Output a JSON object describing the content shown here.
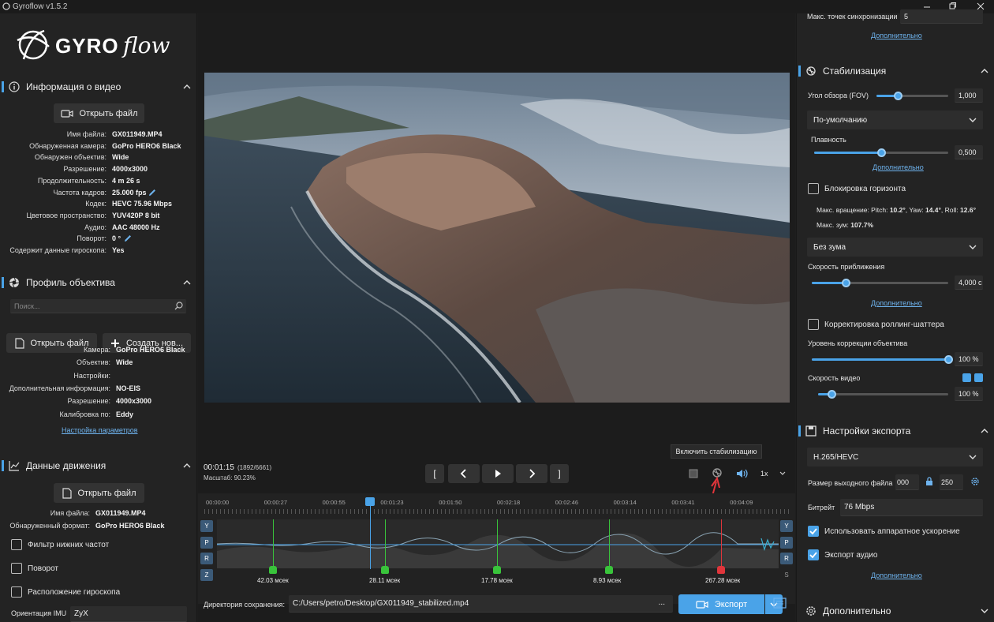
{
  "app": {
    "title": "Gyroflow v1.5.2",
    "logo_text": "GYROflow"
  },
  "colors": {
    "accent": "#4aa3e8",
    "sync_ok": "#39c43b",
    "sync_bad": "#e0353b"
  },
  "video_info": {
    "title": "Информация о видео",
    "open_btn": "Открыть файл",
    "rows": [
      {
        "k": "Имя файла:",
        "v": "GX011949.MP4"
      },
      {
        "k": "Обнаруженная камера:",
        "v": "GoPro HERO6 Black"
      },
      {
        "k": "Обнаружен объектив:",
        "v": "Wide"
      },
      {
        "k": "Разрешение:",
        "v": "4000x3000"
      },
      {
        "k": "Продолжительность:",
        "v": "4 m 26 s"
      },
      {
        "k": "Частота кадров:",
        "v": "25.000 fps"
      },
      {
        "k": "Кодек:",
        "v": "HEVC 75.96 Mbps"
      },
      {
        "k": "Цветовое пространство:",
        "v": "YUV420P 8 bit"
      },
      {
        "k": "Аудио:",
        "v": "AAC 48000 Hz"
      },
      {
        "k": "Поворот:",
        "v": "0 °"
      },
      {
        "k": "Содержит данные гироскопа:",
        "v": "Yes"
      }
    ]
  },
  "lens_profile": {
    "title": "Профиль объектива",
    "search_placeholder": "Поиск...",
    "open_btn": "Открыть файл",
    "create_btn": "Создать нов...",
    "rows": [
      {
        "k": "Камера:",
        "v": "GoPro HERO6 Black"
      },
      {
        "k": "Объектив:",
        "v": "Wide"
      },
      {
        "k": "Настройки:",
        "v": ""
      },
      {
        "k": "Дополнительная информация:",
        "v": "NO-EIS"
      },
      {
        "k": "Разрешение:",
        "v": "4000x3000"
      },
      {
        "k": "Калибровка по:",
        "v": "Eddy"
      }
    ],
    "link": "Настройка параметров"
  },
  "motion": {
    "title": "Данные движения",
    "open_btn": "Открыть файл",
    "rows": [
      {
        "k": "Имя файла:",
        "v": "GX011949.MP4"
      },
      {
        "k": "Обнаруженный формат:",
        "v": "GoPro HERO6 Black"
      }
    ],
    "checks": [
      "Фильтр нижних частот",
      "Поворот",
      "Расположение гироскопа"
    ],
    "imu_label": "Ориентация IMU",
    "imu_value": "ZyX"
  },
  "player": {
    "time": "00:01:15",
    "frames": "(1892/6661)",
    "zoom": "Масштаб: 90.23%",
    "tooltip": "Включить стабилизацию",
    "speed": "1x",
    "bracket_in": "[",
    "bracket_out": "]"
  },
  "timeline": {
    "ticks": [
      "00:00:00",
      "00:00:27",
      "00:00:55",
      "00:01:23",
      "00:01:50",
      "00:02:18",
      "00:02:46",
      "00:03:14",
      "00:03:41",
      "00:04:09"
    ],
    "axes": [
      "Y",
      "P",
      "R",
      "Z"
    ],
    "axes_right": [
      "Y",
      "P",
      "R",
      "S"
    ],
    "sync_points": [
      "42.03 мсек",
      "28.11 мсек",
      "17.78 мсек",
      "8.93 мсек",
      "267.28 мсек"
    ],
    "playhead_fraction": 0.2832
  },
  "output": {
    "dir_label": "Директория сохранения:",
    "path": "C:/Users/petro/Desktop/GX011949_stabilized.mp4",
    "dots": "...",
    "export_btn": "Экспорт"
  },
  "right": {
    "sync_label": "Макс. точек синхронизации",
    "sync_value": "5",
    "more1": "Дополнительно",
    "stab_title": "Стабилизация",
    "fov_label": "Угол обзора (FOV)",
    "fov_value": "1,000",
    "fov_fraction": 0.3,
    "method": "По-умолчанию",
    "smooth_label": "Плавность",
    "smooth_value": "0,500",
    "smooth_fraction": 0.5,
    "more2": "Дополнительно",
    "horizon_label": "Блокировка горизонта",
    "max_rot_text": "Макс. вращение: Pitch: ",
    "pitch": "10.2°",
    "yaw_label": ", Yaw: ",
    "yaw": "14.4°",
    "roll_label": ", Roll:",
    "roll": "12.6°",
    "max_zoom_label": "Макс. зум: ",
    "max_zoom": "107.7%",
    "zoom_mode": "Без зума",
    "zoom_speed_label": "Скорость приближения",
    "zoom_speed_value": "4,000 с",
    "zoom_speed_fraction": 0.25,
    "more3": "Дополнительно",
    "rs_label": "Корректировка роллинг-шаттера",
    "lens_corr_label": "Уровень коррекции объектива",
    "lens_corr_value": "100 %",
    "lens_corr_fraction": 1.0,
    "video_speed_label": "Скорость видео",
    "video_speed_value": "100 %",
    "video_speed_fraction": 0.1,
    "export_title": "Настройки экспорта",
    "codec": "H.265/HEVC",
    "size_label": "Размер выходного файла",
    "width_value": "000",
    "height_value": "250",
    "bitrate_label": "Битрейт",
    "bitrate_value": "76 Mbps",
    "hw_label": "Использовать аппаратное ускорение",
    "audio_label": "Экспорт аудио",
    "more4": "Дополнительно",
    "advanced_title": "Дополнительно"
  }
}
